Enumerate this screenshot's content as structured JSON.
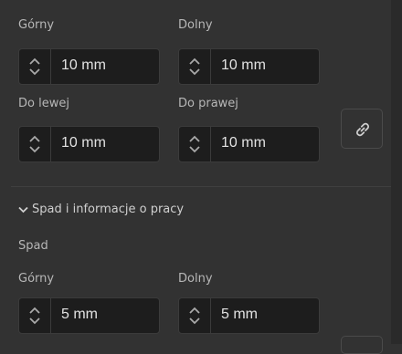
{
  "margins": {
    "top_label": "Górny",
    "top_value": "10 mm",
    "bottom_label": "Dolny",
    "bottom_value": "10 mm",
    "left_label": "Do lewej",
    "left_value": "10 mm",
    "right_label": "Do prawej",
    "right_value": "10 mm",
    "link_icon": "link-icon"
  },
  "section": {
    "title": "Spad i informacje o pracy",
    "chevron_icon": "chevron-down-icon"
  },
  "bleed": {
    "heading": "Spad",
    "top_label": "Górny",
    "top_value": "5 mm",
    "bottom_label": "Dolny",
    "bottom_value": "5 mm"
  }
}
